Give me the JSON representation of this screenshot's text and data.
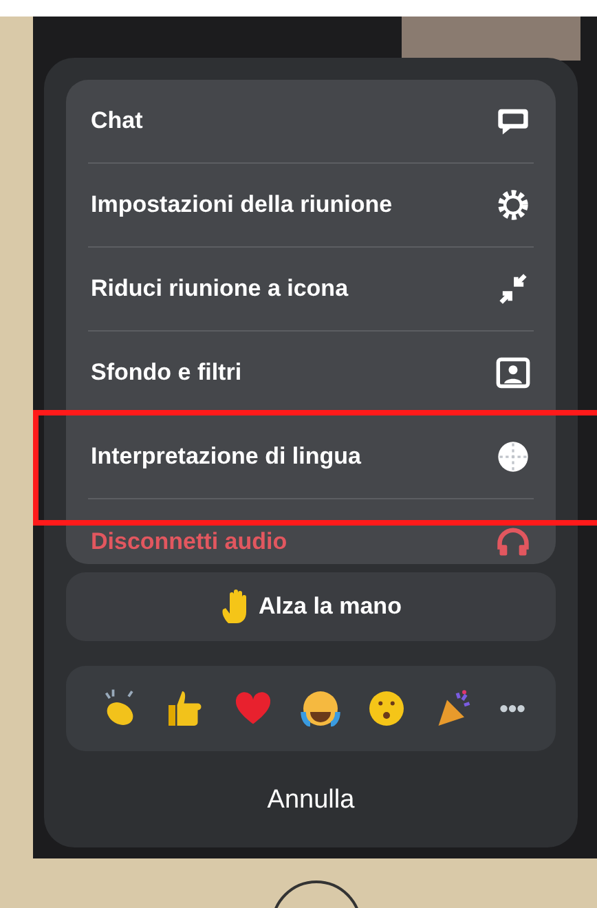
{
  "menu_items": [
    {
      "label": "Chat",
      "kind": "chat",
      "destructive": false,
      "highlighted": false
    },
    {
      "label": "Impostazioni della riunione",
      "kind": "settings",
      "destructive": false,
      "highlighted": false
    },
    {
      "label": "Riduci riunione a icona",
      "kind": "minimize",
      "destructive": false,
      "highlighted": false
    },
    {
      "label": "Sfondo e filtri",
      "kind": "background",
      "destructive": false,
      "highlighted": false
    },
    {
      "label": "Interpretazione di lingua",
      "kind": "language",
      "destructive": false,
      "highlighted": true
    },
    {
      "label": "Disconnetti audio",
      "kind": "audio",
      "destructive": true,
      "highlighted": false
    }
  ],
  "raise_hand": {
    "label": "Alza la mano"
  },
  "reactions": [
    {
      "kind": "clap"
    },
    {
      "kind": "thumbs-up"
    },
    {
      "kind": "heart"
    },
    {
      "kind": "laugh"
    },
    {
      "kind": "surprised"
    },
    {
      "kind": "party"
    }
  ],
  "more_reactions": "•••",
  "cancel": "Annulla"
}
